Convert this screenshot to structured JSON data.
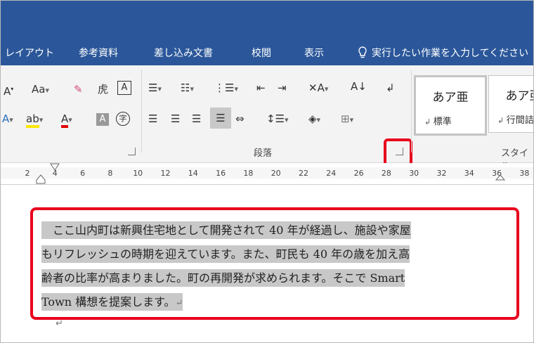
{
  "tabs": [
    "レイアウト",
    "参考資料",
    "差し込み文書",
    "校閲",
    "表示"
  ],
  "tell_me": "実行したい作業を入力してください",
  "ribbon": {
    "font_size_btn": "Aa",
    "group_paragraph_label": "段落",
    "group_styles_label": "スタイル",
    "styles": [
      {
        "sample": "あア亜",
        "name": "標準"
      },
      {
        "sample": "あア亜",
        "name": "行間詰"
      }
    ]
  },
  "ruler_ticks": [
    "2",
    "4",
    "6",
    "8",
    "10",
    "12",
    "14",
    "16",
    "18",
    "20",
    "22",
    "24",
    "26",
    "28",
    "30",
    "32",
    "34",
    "36",
    "38"
  ],
  "document": {
    "lines": [
      "　ここ山内町は新興住宅地として開発されて 40 年が経過し、施設や家屋",
      "もリフレッシュの時期を迎えています。また、町民も 40 年の歳を加え高",
      "齢者の比率が高まりました。町の再開発が求められます。そこで Smart",
      "Town 構想を提案します。"
    ],
    "para_mark": "↵"
  },
  "colors": {
    "brand": "#2b579a",
    "highlight_box": "#e8001c"
  }
}
